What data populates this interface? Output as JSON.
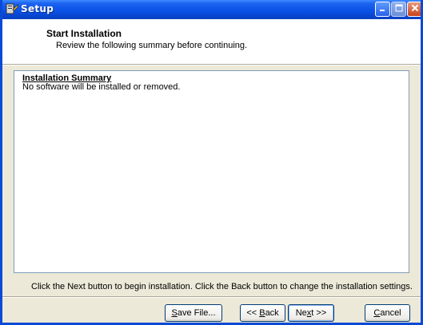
{
  "window": {
    "title": "Setup"
  },
  "colors": {
    "titlebar": "#0a52e6",
    "face": "#ece9d8",
    "close": "#c8421a"
  },
  "header": {
    "title": "Start Installation",
    "subtitle": "Review the following summary before continuing."
  },
  "summary": {
    "heading": "Installation Summary",
    "text": "No software will be installed or removed."
  },
  "footer": {
    "instruction": "Click the Next button to begin installation.  Click the Back button to change the installation settings."
  },
  "buttons": {
    "save": {
      "mnemonic": "S",
      "rest": "ave File..."
    },
    "back": {
      "prefix": "<< ",
      "mnemonic": "B",
      "rest": "ack"
    },
    "next": {
      "prefix": "Ne",
      "mnemonic": "x",
      "rest": "t >>"
    },
    "cancel": {
      "mnemonic": "C",
      "rest": "ancel"
    }
  },
  "icons": {
    "app": "setup-icon",
    "minimize": "minimize-icon",
    "maximize": "maximize-icon",
    "close": "close-icon"
  }
}
